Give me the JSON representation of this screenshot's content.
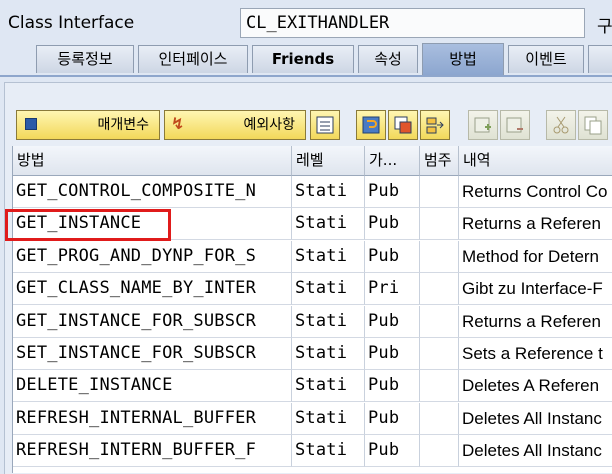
{
  "header": {
    "label": "Class Interface",
    "value": "CL_EXITHANDLER",
    "extra": "구"
  },
  "tabs": [
    {
      "label": "등록정보",
      "active": false
    },
    {
      "label": "인터페이스",
      "active": false
    },
    {
      "label": "Friends",
      "active": false
    },
    {
      "label": "속성",
      "active": false
    },
    {
      "label": "방법",
      "active": true
    },
    {
      "label": "이벤트",
      "active": false
    }
  ],
  "toolbar": {
    "parameters_label": "매개변수",
    "exceptions_label": "예외사항",
    "icons": [
      "detail-view-icon",
      "source-code-icon",
      "copy-method-icon",
      "redefine-icon",
      "insert-row-icon",
      "delete-row-icon",
      "cut-icon",
      "copy-icon"
    ]
  },
  "table": {
    "columns": [
      "방법",
      "레벨",
      "가...",
      "범주",
      "내역"
    ],
    "rows": [
      [
        "GET_CONTROL_COMPOSITE_N",
        "Stati",
        "Pub",
        "",
        "Returns Control Co"
      ],
      [
        "GET_INSTANCE",
        "Stati",
        "Pub",
        "",
        "Returns a Referen"
      ],
      [
        "GET_PROG_AND_DYNP_FOR_S",
        "Stati",
        "Pub",
        "",
        "Method for Detern"
      ],
      [
        "GET_CLASS_NAME_BY_INTER",
        "Stati",
        "Pri",
        "",
        "Gibt zu Interface-F"
      ],
      [
        "GET_INSTANCE_FOR_SUBSCR",
        "Stati",
        "Pub",
        "",
        "Returns a Referen"
      ],
      [
        "SET_INSTANCE_FOR_SUBSCR",
        "Stati",
        "Pub",
        "",
        "Sets a Reference t"
      ],
      [
        "DELETE_INSTANCE",
        "Stati",
        "Pub",
        "",
        "Deletes A Referen"
      ],
      [
        "REFRESH_INTERNAL_BUFFER",
        "Stati",
        "Pub",
        "",
        "Deletes All Instanc"
      ],
      [
        "REFRESH_INTERN_BUFFER_F",
        "Stati",
        "Pub",
        "",
        "Deletes All Instanc"
      ]
    ],
    "highlighted_row": 1
  },
  "colors": {
    "highlight": "#e01b1b",
    "active_tab": "#9bb3d8",
    "toolbar_button": "#f6e27a"
  }
}
